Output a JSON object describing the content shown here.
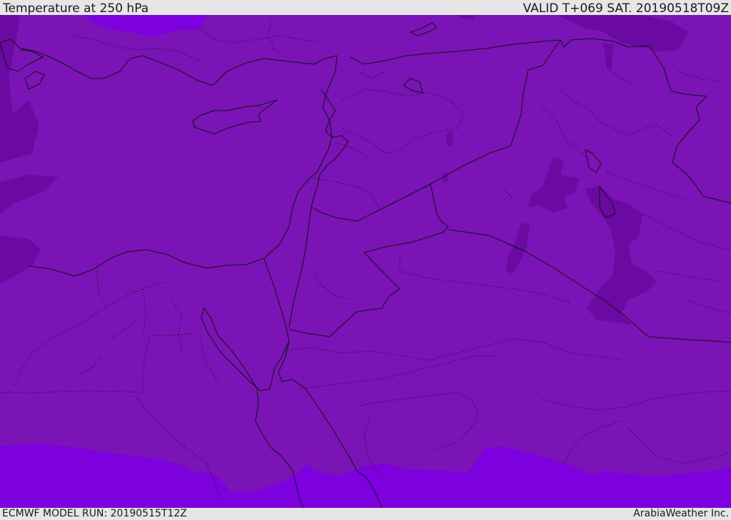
{
  "header": {
    "title": "Temperature at 250 hPa",
    "valid": "VALID T+069 SAT. 20190518T09Z"
  },
  "footer": {
    "model_run": "ECMWF MODEL RUN: 20190515T12Z",
    "credit": "ArabiaWeather Inc."
  },
  "colors": {
    "field_main": "#7a14b6",
    "field_cold": "#6a0aa2",
    "field_warm": "#7d00de",
    "border_line": "#111111",
    "frame_bg": "#e6e6e6"
  }
}
